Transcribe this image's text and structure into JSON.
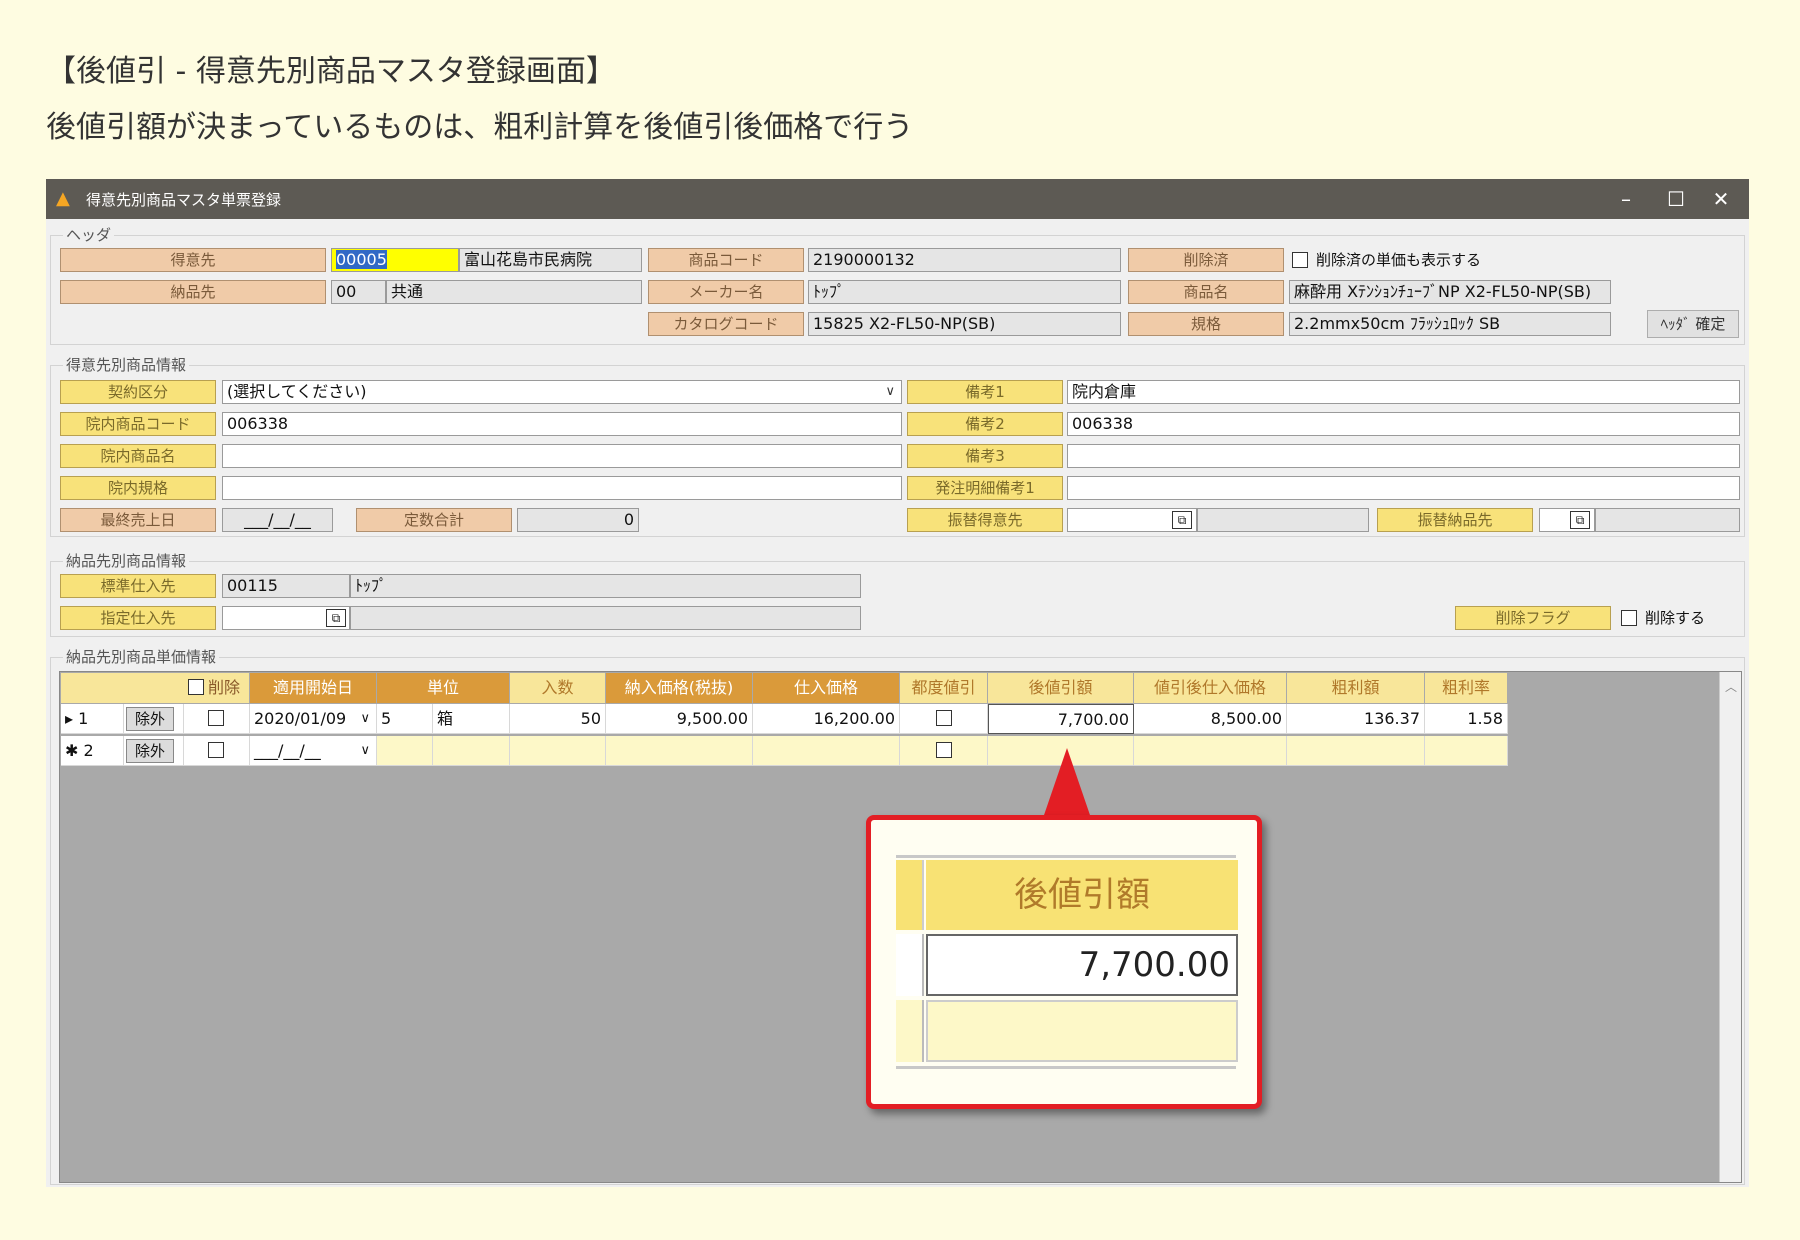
{
  "heading": {
    "title": "【後値引 - 得意先別商品マスタ登録画面】",
    "subtitle": "後値引額が決まっているものは、粗利計算を後値引後価格で行う"
  },
  "window": {
    "title": "得意先別商品マスタ単票登録",
    "minimize": "–",
    "maximize": "☐",
    "close": "✕"
  },
  "header": {
    "group_label": "ヘッダ",
    "customer_label": "得意先",
    "customer_code": "00005",
    "customer_name": "富山花島市民病院",
    "delivery_label": "納品先",
    "delivery_code": "00",
    "delivery_name": "共通",
    "product_code_label": "商品コード",
    "product_code": "2190000132",
    "maker_label": "メーカー名",
    "maker": "ﾄｯﾌﾟ",
    "catalog_label": "カタログコード",
    "catalog_code": "15825 X2-FL50-NP(SB)",
    "deleted_label": "削除済",
    "show_deleted_text": "削除済の単価も表示する",
    "product_name_label": "商品名",
    "product_name": "麻酔用 XﾃﾝｼｮﾝﾁｭｰﾌﾞNP X2-FL50-NP(SB)",
    "spec_label": "規格",
    "spec": "2.2mmx50cm ﾌﾗｯｼｭﾛｯｸ SB",
    "confirm_button": "ﾍｯﾀﾞ 確定"
  },
  "customer_product": {
    "group_label": "得意先別商品情報",
    "contract_label": "契約区分",
    "contract_value": "(選択してください)",
    "hospital_code_label": "院内商品コード",
    "hospital_code": "006338",
    "hospital_name_label": "院内商品名",
    "hospital_name": "",
    "hospital_spec_label": "院内規格",
    "hospital_spec": "",
    "last_sale_label": "最終売上日",
    "last_sale": "___/__/__",
    "fixed_total_label": "定数合計",
    "fixed_total": "0",
    "note1_label": "備考1",
    "note1": "院内倉庫",
    "note2_label": "備考2",
    "note2": "006338",
    "note3_label": "備考3",
    "note3": "",
    "order_note_label": "発注明細備考1",
    "order_note": "",
    "transfer_customer_label": "振替得意先",
    "transfer_delivery_label": "振替納品先"
  },
  "delivery_product": {
    "group_label": "納品先別商品情報",
    "std_supplier_label": "標準仕入先",
    "std_supplier_code": "00115",
    "std_supplier_name": "ﾄｯﾌﾟ",
    "designated_supplier_label": "指定仕入先",
    "delete_flag_label": "削除フラグ",
    "delete_text": "削除する"
  },
  "price_grid": {
    "group_label": "納品先別商品単価情報",
    "headers": {
      "delete": "削除",
      "start_date": "適用開始日",
      "unit": "単位",
      "quantity": "入数",
      "delivery_price": "納入価格(税抜)",
      "purchase_price": "仕入価格",
      "each_discount": "都度値引",
      "rebate": "後値引額",
      "net_purchase": "値引後仕入価格",
      "gross_profit": "粗利額",
      "gross_rate": "粗利率"
    },
    "rows": [
      {
        "marker": "▸ 1",
        "exclude": "除外",
        "start_date": "2020/01/09",
        "unit_qty": "5",
        "unit_name": "箱",
        "quantity": "50",
        "delivery_price": "9,500.00",
        "purchase_price": "16,200.00",
        "rebate": "7,700.00",
        "net_purchase": "8,500.00",
        "gross_profit": "136.37",
        "gross_rate": "1.58"
      },
      {
        "marker": "✱ 2",
        "exclude": "除外",
        "start_date": "___/__/__"
      }
    ]
  },
  "callout": {
    "header": "後値引額",
    "value": "7,700.00"
  }
}
